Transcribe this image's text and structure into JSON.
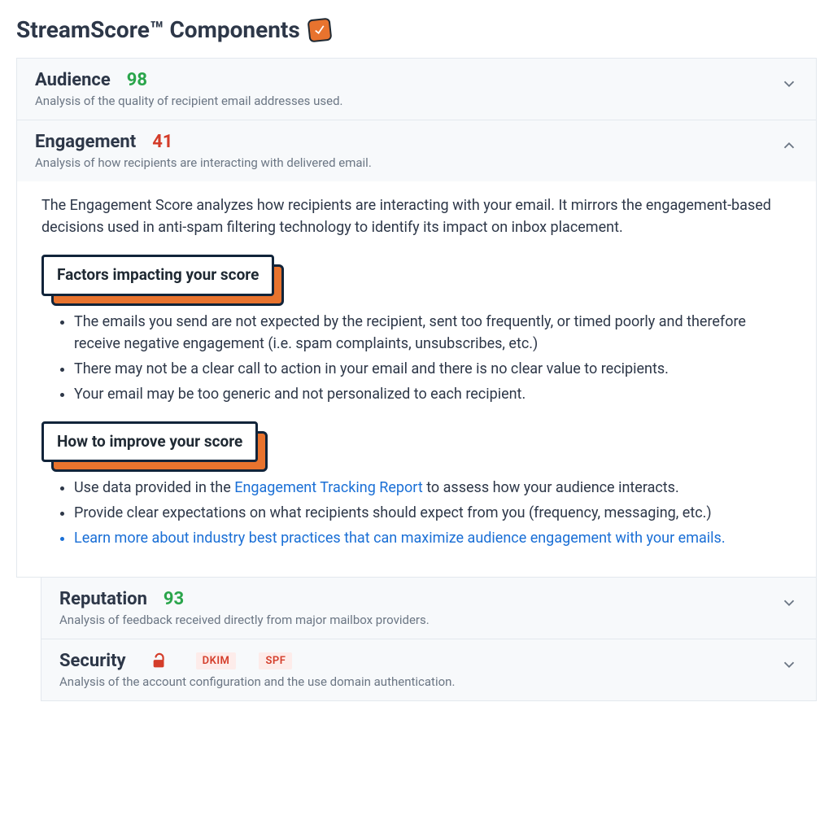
{
  "title": "StreamScore™ Components",
  "panels": {
    "audience": {
      "title": "Audience",
      "score": "98",
      "desc": "Analysis of the quality of recipient email addresses used."
    },
    "engagement": {
      "title": "Engagement",
      "score": "41",
      "desc": "Analysis of how recipients are interacting with delivered email.",
      "intro": "The Engagement Score analyzes how recipients are interacting with your email. It mirrors the engagement-based decisions used in anti-spam filtering technology to identify its impact on inbox placement.",
      "factors_heading": "Factors impacting your score",
      "factors": [
        "The emails you send are not expected by the recipient, sent too frequently, or timed poorly and therefore receive negative engagement (i.e. spam complaints, unsubscribes, etc.)",
        "There may not be a clear call to action in your email and there is no clear value to recipients.",
        "Your email may be too generic and not personalized to each recipient."
      ],
      "improve_heading": "How to improve your score",
      "improve_pre1": "Use data provided in the ",
      "improve_link1": "Engagement Tracking Report",
      "improve_post1": " to assess how your audience interacts.",
      "improve2": "Provide clear expectations on what recipients should expect from you (frequency, messaging, etc.)",
      "improve3": "Learn more about industry best practices that can maximize audience engagement with your emails."
    },
    "reputation": {
      "title": "Reputation",
      "score": "93",
      "desc": "Analysis of feedback received directly from major mailbox providers."
    },
    "security": {
      "title": "Security",
      "tags": {
        "dkim": "DKIM",
        "spf": "SPF"
      },
      "desc": "Analysis of the account configuration and the use domain authentication."
    }
  }
}
